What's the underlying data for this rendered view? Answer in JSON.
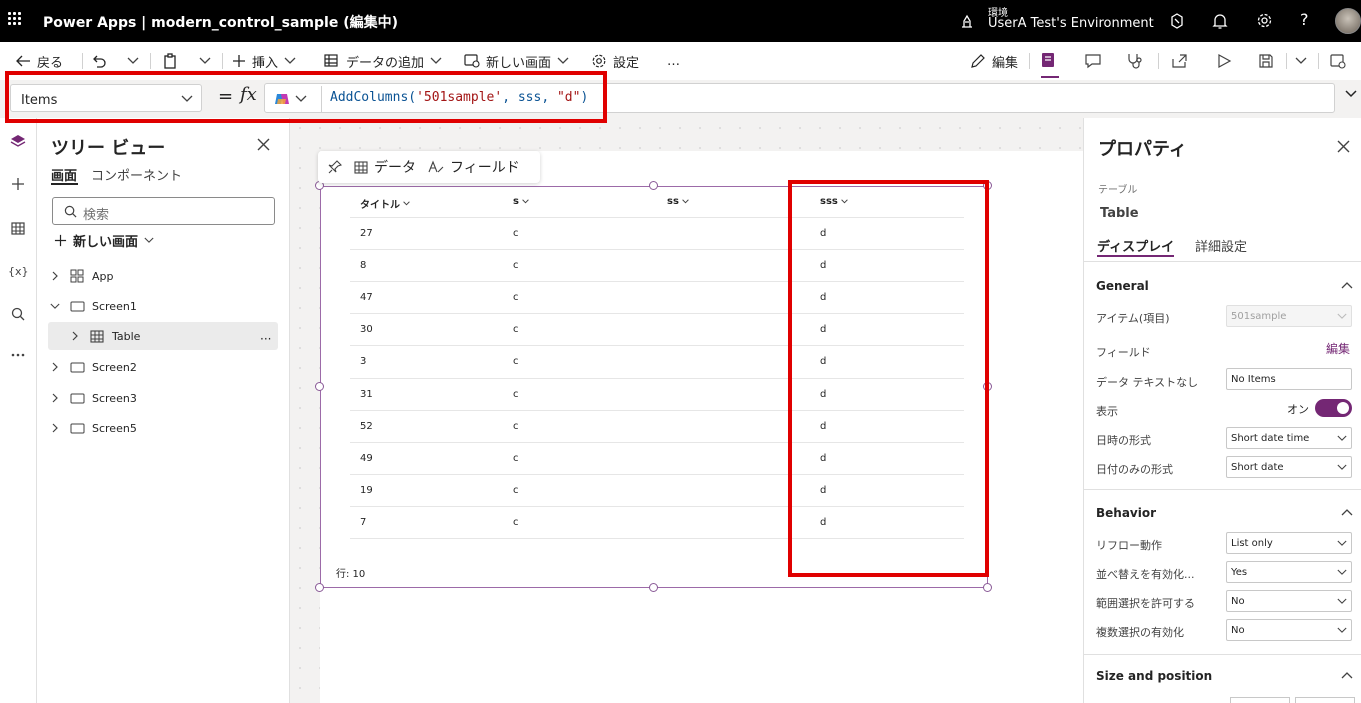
{
  "titlebar": {
    "app_name": "Power Apps  |  modern_control_sample (編集中)",
    "env_label": "環境",
    "env_name": "UserA Test's Environment"
  },
  "commandbar": {
    "back": "戻る",
    "insert": "挿入",
    "add_data": "データの追加",
    "new_screen": "新しい画面",
    "settings": "設定",
    "more": "…",
    "edit": "編集"
  },
  "formula": {
    "property": "Items",
    "equals": "=",
    "fx": "fx",
    "prefix": "AddColumns(",
    "arg1": "'501sample'",
    "mid": ", sss, ",
    "arg3": "\"d\"",
    "suffix": ")"
  },
  "tree": {
    "title": "ツリー ビュー",
    "tab_screens": "画面",
    "tab_components": "コンポーネント",
    "search_placeholder": "検索",
    "new_screen": "新しい画面",
    "nodes": [
      {
        "label": "App"
      },
      {
        "label": "Screen1"
      },
      {
        "label": "Table"
      },
      {
        "label": "Screen2"
      },
      {
        "label": "Screen3"
      },
      {
        "label": "Screen5"
      }
    ]
  },
  "canvas": {
    "toolbar_data": "データ",
    "toolbar_fields": "フィールド",
    "columns": [
      "タイトル",
      "s",
      "ss",
      "sss"
    ],
    "rows": [
      [
        "27",
        "c",
        "",
        "d"
      ],
      [
        "8",
        "c",
        "",
        "d"
      ],
      [
        "47",
        "c",
        "",
        "d"
      ],
      [
        "30",
        "c",
        "",
        "d"
      ],
      [
        "3",
        "c",
        "",
        "d"
      ],
      [
        "31",
        "c",
        "",
        "d"
      ],
      [
        "52",
        "c",
        "",
        "d"
      ],
      [
        "49",
        "c",
        "",
        "d"
      ],
      [
        "19",
        "c",
        "",
        "d"
      ],
      [
        "7",
        "c",
        "",
        "d"
      ]
    ],
    "row_count": "行: 10"
  },
  "props": {
    "title": "プロパティ",
    "type_label": "テーブル",
    "control_name": "Table",
    "tab_display": "ディスプレイ",
    "tab_advanced": "詳細設定",
    "general": {
      "header": "General",
      "items_label": "アイテム(項目)",
      "items_value": "501sample",
      "fields_label": "フィールド",
      "fields_edit": "編集",
      "no_data_label": "データ テキストなし",
      "no_data_value": "No Items",
      "visible_label": "表示",
      "visible_state": "オン",
      "datetime_label": "日時の形式",
      "datetime_value": "Short date time",
      "dateonly_label": "日付のみの形式",
      "dateonly_value": "Short date"
    },
    "behavior": {
      "header": "Behavior",
      "reflow_label": "リフロー動作",
      "reflow_value": "List only",
      "sort_label": "並べ替えを有効化...",
      "sort_value": "Yes",
      "range_label": "範囲選択を許可する",
      "range_value": "No",
      "multi_label": "複数選択の有効化",
      "multi_value": "No"
    },
    "size": {
      "header": "Size and position"
    }
  },
  "colors": {
    "accent": "#742774",
    "highlight": "#e00000"
  }
}
